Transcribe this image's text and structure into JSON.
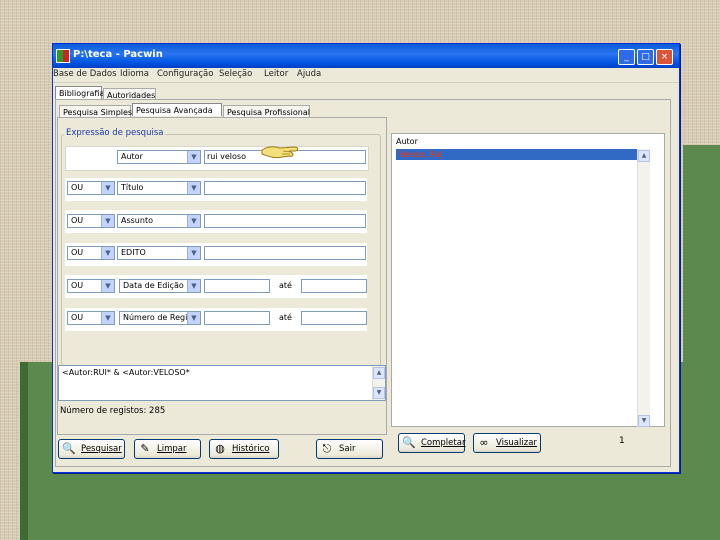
{
  "window": {
    "title": "P:\\teca - Pacwin",
    "min": "_",
    "max": "□",
    "close": "×"
  },
  "menu": [
    "Base de Dados",
    "Idioma",
    "Configuração",
    "Seleção",
    "Leitor",
    "Ajuda"
  ],
  "outer_tabs": [
    "Bibliografia",
    "Autoridades"
  ],
  "inner_tabs": [
    "Pesquisa Simples",
    "Pesquisa Avançada",
    "Pesquisa Profissional"
  ],
  "search": {
    "legend": "Expressão de pesquisa",
    "rows": [
      {
        "op": "",
        "field": "Autor",
        "value": "rui veloso"
      },
      {
        "op": "OU",
        "field": "Título",
        "value": ""
      },
      {
        "op": "OU",
        "field": "Assunto",
        "value": ""
      },
      {
        "op": "OU",
        "field": "EDITO",
        "value": ""
      },
      {
        "op": "OU",
        "field": "Data de Edição",
        "value": "",
        "to_label": "até",
        "to_value": ""
      },
      {
        "op": "OU",
        "field": "Número de Regi",
        "value": "",
        "to_label": "até",
        "to_value": ""
      }
    ],
    "expression": "<Autor:RUI* & <Autor:VELOSO*",
    "records": "Número de registos: 285"
  },
  "results": {
    "header": "Autor",
    "items": [
      "Veloso, Rui"
    ],
    "count": "1"
  },
  "buttons": {
    "search": "Pesquisar",
    "clear": "Limpar",
    "history": "Histórico",
    "exit": "Sair",
    "complete": "Completar",
    "view": "Visualizar"
  },
  "icons": {
    "hand": "pointing-hand-icon",
    "search": "magnifier-icon",
    "clear": "eraser-icon",
    "history": "globe-icon",
    "exit": "exit-door-icon",
    "complete": "magnifier-icon",
    "view": "binoculars-icon"
  },
  "colors": {
    "titlebar": "#0a5bd8",
    "selection": "#316ac5",
    "selection_text": "#ff3300",
    "legend": "#1c3aa9",
    "background_green": "#5c8a4e"
  }
}
